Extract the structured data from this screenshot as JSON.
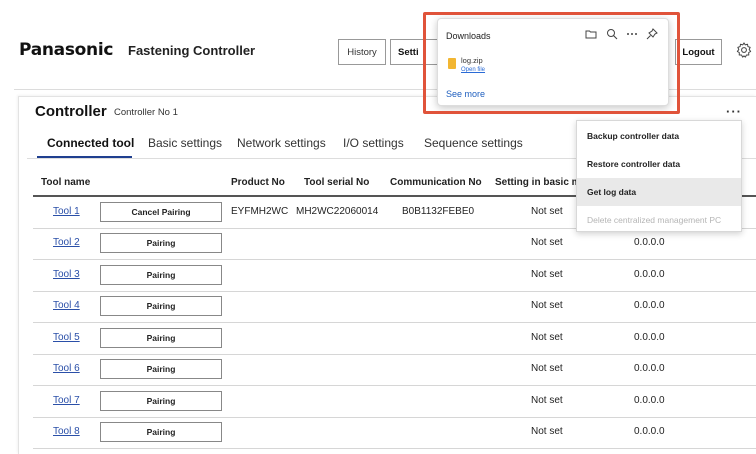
{
  "header": {
    "logo": "Panasonic",
    "app_title": "Fastening Controller",
    "history_label": "History",
    "settings_label": "Setti",
    "logout_label": "Logout"
  },
  "controller": {
    "title": "Controller",
    "name": "Controller No 1",
    "more": "···"
  },
  "tabs": [
    {
      "label": "Connected tool",
      "active": true
    },
    {
      "label": "Basic settings"
    },
    {
      "label": "Network settings"
    },
    {
      "label": "I/O settings"
    },
    {
      "label": "Sequence settings"
    }
  ],
  "table": {
    "columns": [
      "Tool name",
      "Product No",
      "Tool serial No",
      "Communication No",
      "Setting in basic m"
    ],
    "rows": [
      {
        "tool": "Tool 1",
        "button": "Cancel Pairing",
        "product": "EYFMH2WC",
        "serial": "MH2WC22060014",
        "comm": "B0B1132FEBE0",
        "setting": "Not set",
        "version": ""
      },
      {
        "tool": "Tool 2",
        "button": "Pairing",
        "product": "",
        "serial": "",
        "comm": "",
        "setting": "Not set",
        "version": "0.0.0.0"
      },
      {
        "tool": "Tool 3",
        "button": "Pairing",
        "product": "",
        "serial": "",
        "comm": "",
        "setting": "Not set",
        "version": "0.0.0.0"
      },
      {
        "tool": "Tool 4",
        "button": "Pairing",
        "product": "",
        "serial": "",
        "comm": "",
        "setting": "Not set",
        "version": "0.0.0.0"
      },
      {
        "tool": "Tool 5",
        "button": "Pairing",
        "product": "",
        "serial": "",
        "comm": "",
        "setting": "Not set",
        "version": "0.0.0.0"
      },
      {
        "tool": "Tool 6",
        "button": "Pairing",
        "product": "",
        "serial": "",
        "comm": "",
        "setting": "Not set",
        "version": "0.0.0.0"
      },
      {
        "tool": "Tool 7",
        "button": "Pairing",
        "product": "",
        "serial": "",
        "comm": "",
        "setting": "Not set",
        "version": "0.0.0.0"
      },
      {
        "tool": "Tool 8",
        "button": "Pairing",
        "product": "",
        "serial": "",
        "comm": "",
        "setting": "Not set",
        "version": "0.0.0.0"
      }
    ]
  },
  "menu": {
    "items": [
      {
        "label": "Backup controller data"
      },
      {
        "label": "Restore controller data"
      },
      {
        "label": "Get log data",
        "hover": true
      },
      {
        "label": "Delete centralized management PC",
        "disabled": true
      }
    ]
  },
  "downloads": {
    "title": "Downloads",
    "file_name": "log.zip",
    "open_file": "Open file",
    "see_more": "See more",
    "icons": [
      "folder-icon",
      "search-icon",
      "more-icon",
      "pin-icon"
    ],
    "highlight_color": "#e0533a"
  }
}
